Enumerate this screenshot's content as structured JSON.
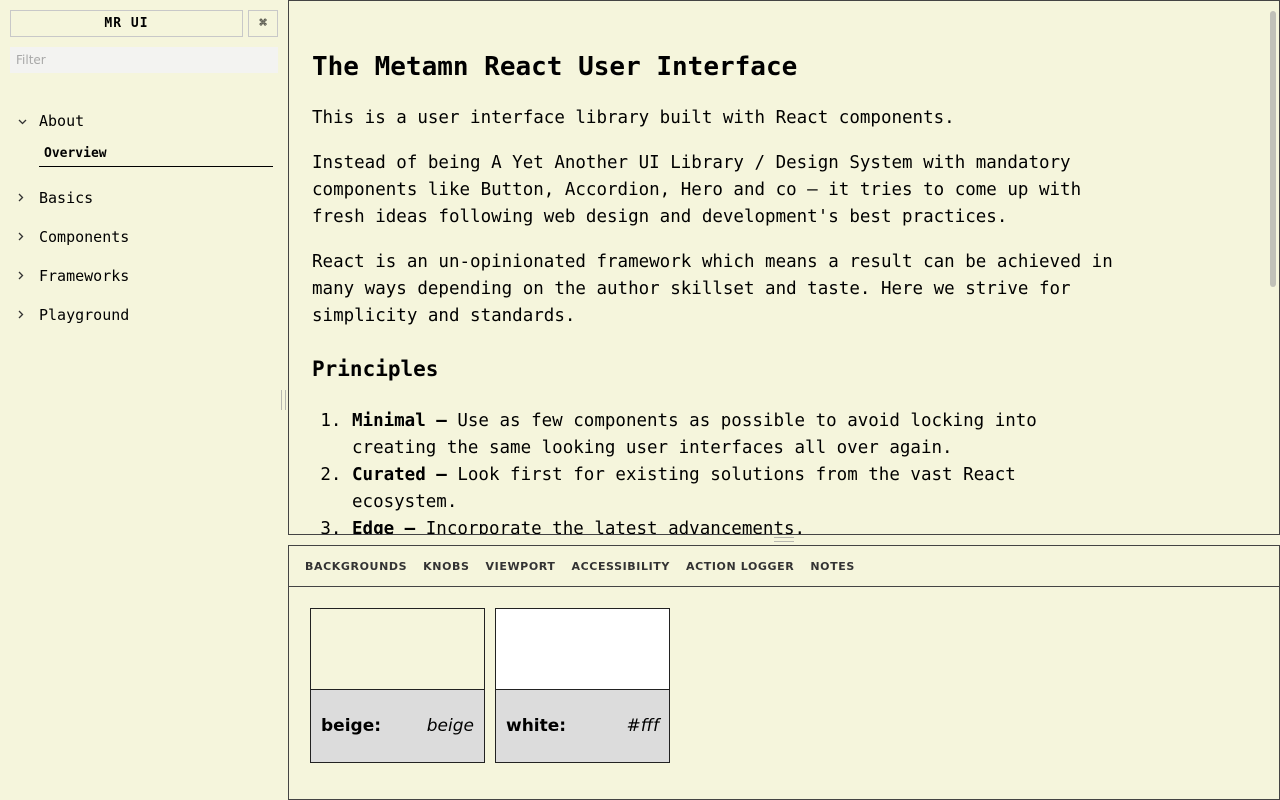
{
  "sidebar": {
    "brand": "MR UI",
    "shortcut": "⌘",
    "filter_placeholder": "Filter",
    "items": [
      {
        "label": "About",
        "expanded": true,
        "chevron": "chevron-down-icon",
        "children": [
          {
            "label": "Overview",
            "selected": true
          }
        ]
      },
      {
        "label": "Basics",
        "expanded": false,
        "chevron": "chevron-right-icon"
      },
      {
        "label": "Components",
        "expanded": false,
        "chevron": "chevron-right-icon"
      },
      {
        "label": "Frameworks",
        "expanded": false,
        "chevron": "chevron-right-icon"
      },
      {
        "label": "Playground",
        "expanded": false,
        "chevron": "chevron-right-icon"
      }
    ]
  },
  "preview": {
    "title": "The Metamn React User Interface",
    "paragraphs": [
      "This is a user interface library built with React components.",
      "Instead of being A Yet Another UI Library / Design System with mandatory components like Button, Accordion, Hero and co — it tries to come up with fresh ideas following web design and development's best practices.",
      "React is an un-opinionated framework which means a result can be achieved in many ways depending on the author skillset and taste. Here we strive for simplicity and standards."
    ],
    "principles_heading": "Principles",
    "principles": [
      {
        "term": "Minimal —",
        "text": " Use as few components as possible to avoid locking into creating the same looking user interfaces all over again."
      },
      {
        "term": "Curated —",
        "text": " Look first for existing solutions from the vast React ecosystem."
      },
      {
        "term": "Edge —",
        "text": " Incorporate the latest advancements."
      }
    ]
  },
  "addons": {
    "tabs": [
      "BACKGROUNDS",
      "KNOBS",
      "VIEWPORT",
      "ACCESSIBILITY",
      "ACTION LOGGER",
      "NOTES"
    ],
    "backgrounds": [
      {
        "name": "beige:",
        "value": "beige",
        "color": "#f5f5dc"
      },
      {
        "name": "white:",
        "value": "#fff",
        "color": "#ffffff"
      }
    ]
  },
  "colors": {
    "background": "#f5f5dc",
    "swatch_info": "#dcdcdc",
    "border": "#444444"
  }
}
